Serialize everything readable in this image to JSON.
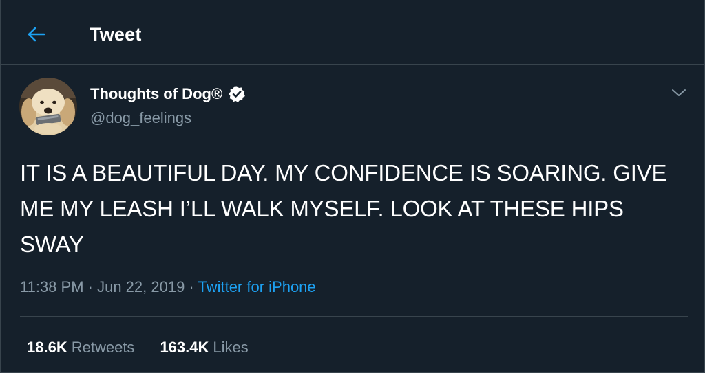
{
  "header": {
    "title": "Tweet",
    "back_icon": "arrow-left-icon"
  },
  "author": {
    "display_name": "Thoughts of Dog®",
    "handle": "@dog_feelings",
    "verified_icon": "verified-badge-icon"
  },
  "tweet": {
    "text": "IT IS A BEAUTIFUL DAY. MY CONFIDENCE IS SOARING. GIVE ME MY LEASH I’LL WALK MYSELF. LOOK AT THESE HIPS SWAY",
    "time": "11:38 PM · Jun 22, 2019",
    "separator": " · ",
    "source": "Twitter for iPhone"
  },
  "stats": {
    "retweets_count": "18.6K",
    "retweets_label": "Retweets",
    "likes_count": "163.4K",
    "likes_label": "Likes"
  },
  "colors": {
    "background": "#15202b",
    "border": "#38444d",
    "accent": "#1da1f2",
    "secondary_text": "#8899a6",
    "primary_text": "#ffffff"
  }
}
